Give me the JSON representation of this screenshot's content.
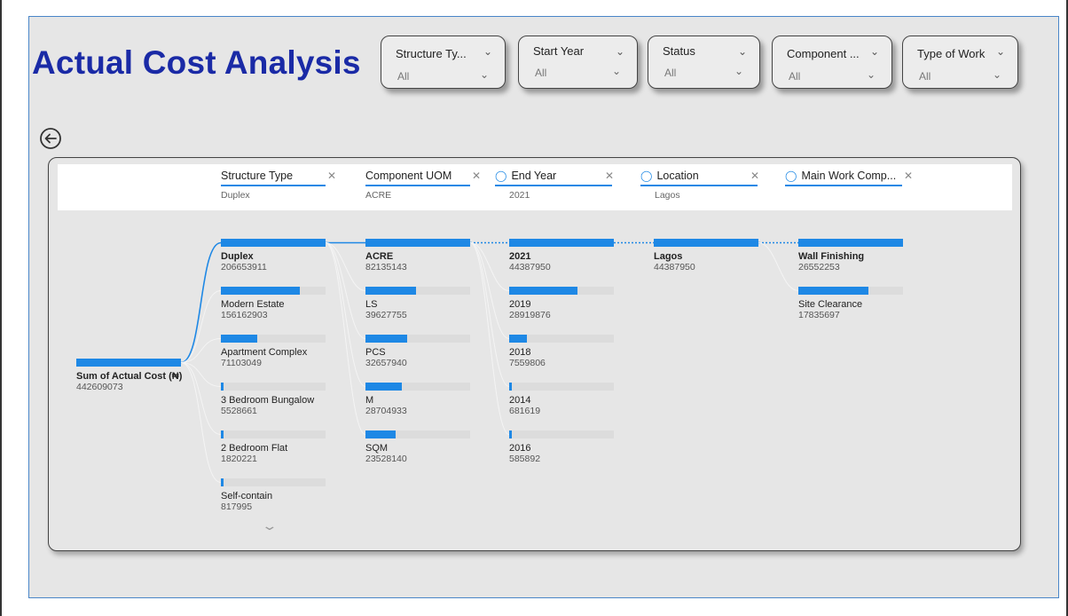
{
  "title": "Actual Cost Analysis",
  "slicers": [
    {
      "label": "Structure Ty...",
      "value": "All"
    },
    {
      "label": "Start Year",
      "value": "All"
    },
    {
      "label": "Status",
      "value": "All"
    },
    {
      "label": "Component ...",
      "value": "All"
    },
    {
      "label": "Type of Work",
      "value": "All"
    }
  ],
  "tree": {
    "root": {
      "label": "Sum of Actual Cost (₦)",
      "value": "442609073",
      "fraction": 1.0
    },
    "levels": [
      {
        "name": "Structure Type",
        "selected": "Duplex",
        "ai_split": false,
        "nodes": [
          {
            "label": "Duplex",
            "value": "206653911",
            "fraction": 1.0,
            "selected": true
          },
          {
            "label": "Modern Estate",
            "value": "156162903",
            "fraction": 0.756
          },
          {
            "label": "Apartment Complex",
            "value": "71103049",
            "fraction": 0.344
          },
          {
            "label": "3 Bedroom Bungalow",
            "value": "5528661",
            "fraction": 0.027
          },
          {
            "label": "2 Bedroom Flat",
            "value": "1820221",
            "fraction": 0.009
          },
          {
            "label": "Self-contain",
            "value": "817995",
            "fraction": 0.004
          }
        ]
      },
      {
        "name": "Component UOM",
        "selected": "ACRE",
        "ai_split": false,
        "nodes": [
          {
            "label": "ACRE",
            "value": "82135143",
            "fraction": 1.0,
            "selected": true
          },
          {
            "label": "LS",
            "value": "39627755",
            "fraction": 0.482
          },
          {
            "label": "PCS",
            "value": "32657940",
            "fraction": 0.398
          },
          {
            "label": "M",
            "value": "28704933",
            "fraction": 0.349
          },
          {
            "label": "SQM",
            "value": "23528140",
            "fraction": 0.286
          }
        ]
      },
      {
        "name": "End Year",
        "selected": "2021",
        "ai_split": true,
        "nodes": [
          {
            "label": "2021",
            "value": "44387950",
            "fraction": 1.0,
            "selected": true
          },
          {
            "label": "2019",
            "value": "28919876",
            "fraction": 0.652
          },
          {
            "label": "2018",
            "value": "7559806",
            "fraction": 0.17
          },
          {
            "label": "2014",
            "value": "681619",
            "fraction": 0.015
          },
          {
            "label": "2016",
            "value": "585892",
            "fraction": 0.013
          }
        ]
      },
      {
        "name": "Location",
        "selected": "Lagos",
        "ai_split": true,
        "nodes": [
          {
            "label": "Lagos",
            "value": "44387950",
            "fraction": 1.0,
            "selected": true
          }
        ]
      },
      {
        "name": "Main Work Comp...",
        "selected": "",
        "ai_split": true,
        "nodes": [
          {
            "label": "Wall Finishing",
            "value": "26552253",
            "fraction": 1.0,
            "selected": true
          },
          {
            "label": "Site Clearance",
            "value": "17835697",
            "fraction": 0.672
          }
        ]
      }
    ]
  },
  "colors": {
    "accent": "#1e88e5",
    "title": "#1a2aa6",
    "track": "#dcdcdc"
  },
  "icons": {
    "back": "back-arrow-circle-icon",
    "chevron": "chevron-down-icon",
    "close": "close-icon",
    "bulb": "lightbulb-icon",
    "more": "chevron-down-icon"
  }
}
